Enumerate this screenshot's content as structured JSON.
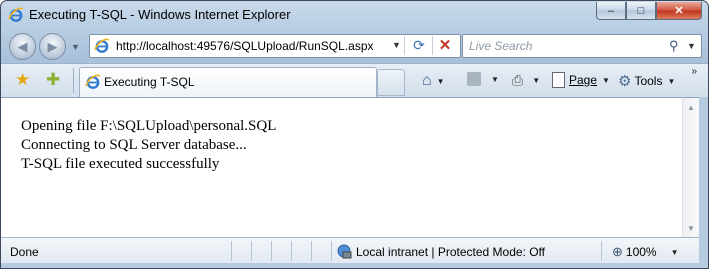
{
  "window": {
    "title": "Executing T-SQL - Windows Internet Explorer",
    "controls": {
      "minimize": "–",
      "maximize": "□",
      "close": "✕"
    }
  },
  "navigation": {
    "address_url": "http://localhost:49576/SQLUpload/RunSQL.aspx",
    "search_placeholder": "Live Search"
  },
  "tabs": [
    {
      "label": "Executing T-SQL",
      "active": true
    }
  ],
  "toolbar": {
    "page_label": "Page",
    "tools_label": "Tools",
    "overflow": "»"
  },
  "content": {
    "lines": [
      "Opening file F:\\SQLUpload\\personal.SQL",
      "Connecting to SQL Server database...",
      "T-SQL file executed successfully"
    ]
  },
  "status": {
    "text": "Done",
    "zone": "Local intranet | Protected Mode: Off",
    "zoom": "100%"
  },
  "colors": {
    "frame": "#b6cbe0",
    "close_button": "#c0341c",
    "ie_logo": "#2f7bd1"
  }
}
